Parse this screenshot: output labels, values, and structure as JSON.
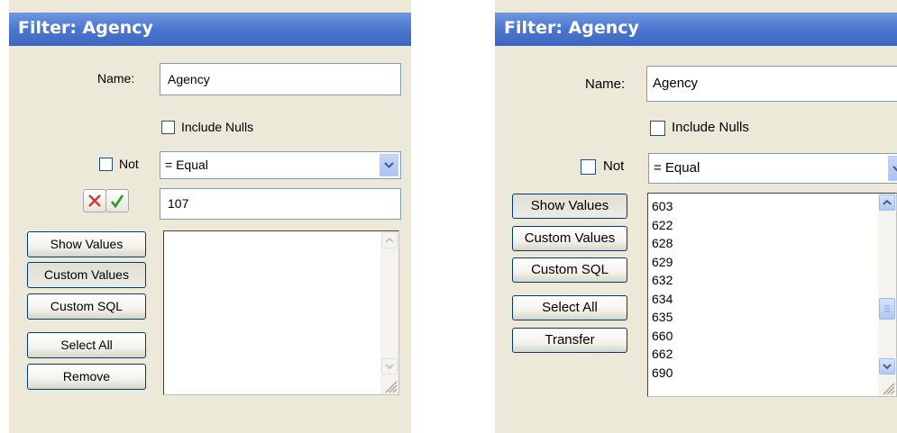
{
  "left": {
    "title": "Filter: Agency",
    "name_label": "Name:",
    "name_value": "Agency",
    "include_nulls_label": "Include Nulls",
    "not_label": "Not",
    "operator_value": "= Equal",
    "value_input": "107",
    "buttons": {
      "show_values": "Show Values",
      "custom_values": "Custom Values",
      "custom_sql": "Custom SQL",
      "select_all": "Select All",
      "remove": "Remove"
    },
    "icons": {
      "cancel": "x-icon",
      "accept": "checkmark-icon"
    }
  },
  "right": {
    "title": "Filter: Agency",
    "name_label": "Name:",
    "name_value": "Agency",
    "include_nulls_label": "Include Nulls",
    "not_label": "Not",
    "operator_value": "= Equal",
    "buttons": {
      "show_values": "Show Values",
      "custom_values": "Custom Values",
      "custom_sql": "Custom SQL",
      "select_all": "Select All",
      "transfer": "Transfer"
    },
    "values_list": [
      "603",
      "622",
      "628",
      "629",
      "632",
      "634",
      "635",
      "660",
      "662",
      "690"
    ]
  },
  "colors": {
    "titlebar": "#4b76cf",
    "panel": "#ece9d8",
    "accept_green": "#2d9b2d",
    "cancel_red": "#d23a3a"
  }
}
